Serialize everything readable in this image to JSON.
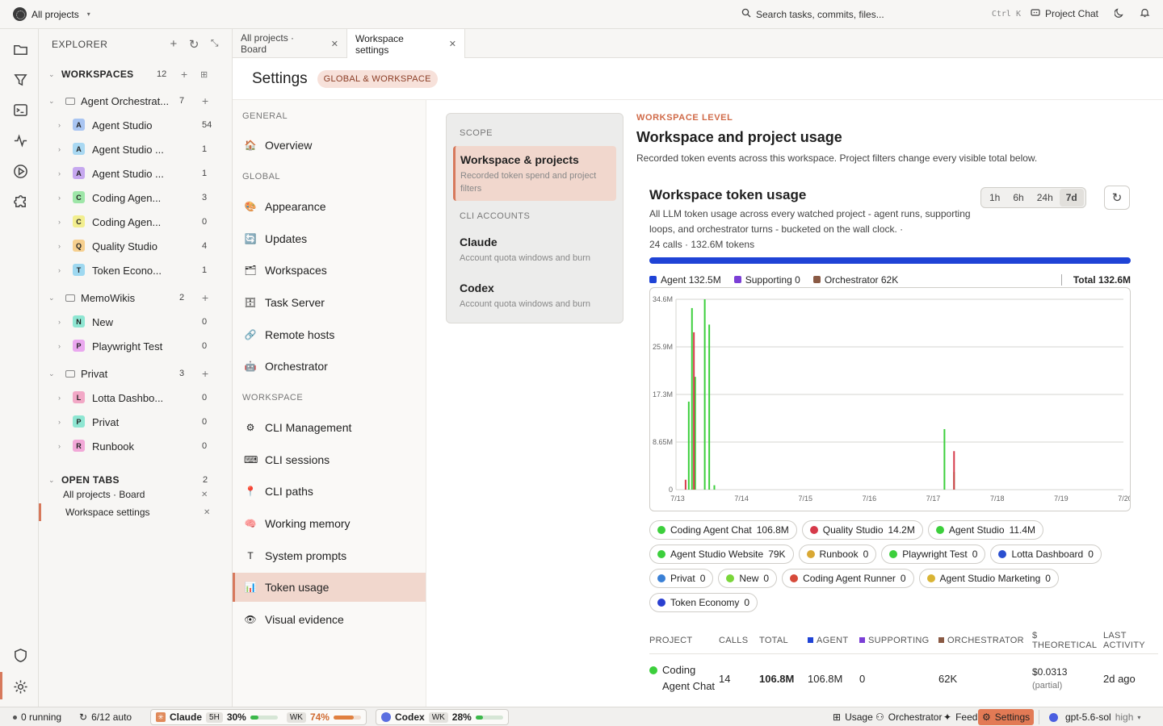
{
  "topbar": {
    "project_label": "All projects",
    "search_placeholder": "Search tasks, commits, files...",
    "shortcut": "Ctrl K",
    "project_chat": "Project Chat"
  },
  "explorer": {
    "title": "EXPLORER",
    "workspaces_label": "WORKSPACES",
    "workspaces_count": "12",
    "groups": [
      {
        "name": "Agent Orchestrat...",
        "count": "7",
        "items": [
          {
            "letter": "A",
            "name": "Agent Studio",
            "count": "54",
            "color": "#a9c5f2"
          },
          {
            "letter": "A",
            "name": "Agent Studio ...",
            "count": "1",
            "color": "#a9d8f2"
          },
          {
            "letter": "A",
            "name": "Agent Studio ...",
            "count": "1",
            "color": "#c6a8ef"
          },
          {
            "letter": "C",
            "name": "Coding Agen...",
            "count": "3",
            "color": "#9ee6a8"
          },
          {
            "letter": "C",
            "name": "Coding Agen...",
            "count": "0",
            "color": "#f2ee8e"
          },
          {
            "letter": "Q",
            "name": "Quality Studio",
            "count": "4",
            "color": "#f6cf8e"
          },
          {
            "letter": "T",
            "name": "Token Econo...",
            "count": "1",
            "color": "#9ed8f0"
          }
        ]
      },
      {
        "name": "MemoWikis",
        "count": "2",
        "items": [
          {
            "letter": "N",
            "name": "New",
            "count": "0",
            "color": "#8ee6d2"
          },
          {
            "letter": "P",
            "name": "Playwright Test",
            "count": "0",
            "color": "#eaa8ef"
          }
        ]
      },
      {
        "name": "Privat",
        "count": "3",
        "items": [
          {
            "letter": "L",
            "name": "Lotta Dashbo...",
            "count": "0",
            "color": "#f2a8c6"
          },
          {
            "letter": "P",
            "name": "Privat",
            "count": "0",
            "color": "#8ee6d2"
          },
          {
            "letter": "R",
            "name": "Runbook",
            "count": "0",
            "color": "#f2a8d8"
          }
        ]
      }
    ],
    "open_tabs_label": "OPEN TABS",
    "open_tabs_count": "2",
    "open_tabs": [
      "All projects · Board",
      "Workspace settings"
    ]
  },
  "tabs": [
    {
      "label": "All projects · Board"
    },
    {
      "label": "Workspace settings"
    }
  ],
  "settings": {
    "title": "Settings",
    "badge": "GLOBAL & WORKSPACE",
    "nav": {
      "general_label": "GENERAL",
      "global_label": "GLOBAL",
      "workspace_label": "WORKSPACE",
      "general": [
        {
          "icon": "🏠",
          "label": "Overview"
        }
      ],
      "global": [
        {
          "icon": "🎨",
          "label": "Appearance"
        },
        {
          "icon": "🔄",
          "label": "Updates"
        },
        {
          "icon": "🗂",
          "label": "Workspaces"
        },
        {
          "icon": "🗄",
          "label": "Task Server"
        },
        {
          "icon": "🔗",
          "label": "Remote hosts"
        },
        {
          "icon": "🤖",
          "label": "Orchestrator"
        }
      ],
      "workspace": [
        {
          "icon": "⚙",
          "label": "CLI Management"
        },
        {
          "icon": "⌨",
          "label": "CLI sessions"
        },
        {
          "icon": "📍",
          "label": "CLI paths"
        },
        {
          "icon": "🧠",
          "label": "Working memory"
        },
        {
          "icon": "T",
          "label": "System prompts"
        },
        {
          "icon": "📊",
          "label": "Token usage"
        },
        {
          "icon": "👁",
          "label": "Visual evidence"
        }
      ]
    },
    "scope": {
      "scope_label": "SCOPE",
      "cli_label": "CLI ACCOUNTS",
      "selected_title": "Workspace & projects",
      "selected_desc": "Recorded token spend and project filters",
      "claude_title": "Claude",
      "claude_desc": "Account quota windows and burn",
      "codex_title": "Codex",
      "codex_desc": "Account quota windows and burn"
    },
    "content": {
      "eyebrow": "WORKSPACE LEVEL",
      "title": "Workspace and project usage",
      "subtitle": "Recorded token events across this workspace. Project filters change every visible total below.",
      "card_title": "Workspace token usage",
      "card_desc": "All LLM token usage across every watched project - agent runs, supporting loops, and orchestrator turns - bucketed on the wall clock. ·",
      "card_stats": "24 calls · 132.6M tokens",
      "ranges": [
        "1h",
        "6h",
        "24h",
        "7d"
      ],
      "selected_range": "7d",
      "legend": {
        "agent": "Agent",
        "agent_val": "132.5M",
        "supporting": "Supporting",
        "supporting_val": "0",
        "orchestrator": "Orchestrator",
        "orchestrator_val": "62K",
        "total": "Total 132.6M"
      },
      "colors": {
        "agent": "#1f43d6",
        "supporting": "#7b3fd6",
        "orchestrator": "#8a5a44"
      }
    }
  },
  "chart_data": {
    "type": "bar",
    "y_ticks": [
      "0",
      "8.65M",
      "17.3M",
      "25.9M",
      "34.6M"
    ],
    "x_ticks": [
      "7/13",
      "7/14",
      "7/15",
      "7/16",
      "7/17",
      "7/18",
      "7/19",
      "7/20"
    ],
    "ylim": [
      0,
      34.6
    ],
    "xlim": [
      0,
      7
    ],
    "series": [
      {
        "name": "Coding Agent Chat",
        "color": "#3ccf3c",
        "points": [
          [
            0.2,
            16
          ],
          [
            0.25,
            33
          ],
          [
            0.3,
            20.5
          ],
          [
            0.45,
            34.6
          ],
          [
            0.52,
            30
          ],
          [
            0.6,
            0.8
          ],
          [
            4.2,
            11
          ],
          [
            4.35,
            3.2
          ]
        ]
      },
      {
        "name": "Quality Studio",
        "color": "#d63a4a",
        "points": [
          [
            0.15,
            1.8
          ],
          [
            0.28,
            28.6
          ],
          [
            4.35,
            7.0
          ]
        ]
      }
    ]
  },
  "pills": [
    {
      "name": "Coding Agent Chat",
      "val": "106.8M",
      "color": "#3ccf3c"
    },
    {
      "name": "Quality Studio",
      "val": "14.2M",
      "color": "#d63a4a"
    },
    {
      "name": "Agent Studio",
      "val": "11.4M",
      "color": "#3ccf3c"
    },
    {
      "name": "Agent Studio Website",
      "val": "79K",
      "color": "#3ccf3c"
    },
    {
      "name": "Runbook",
      "val": "0",
      "color": "#d9a834"
    },
    {
      "name": "Playwright Test",
      "val": "0",
      "color": "#3ccf3c"
    },
    {
      "name": "Lotta Dashboard",
      "val": "0",
      "color": "#2a4fd0"
    },
    {
      "name": "Privat",
      "val": "0",
      "color": "#3a80d6"
    },
    {
      "name": "New",
      "val": "0",
      "color": "#7ad63a"
    },
    {
      "name": "Coding Agent Runner",
      "val": "0",
      "color": "#d64a3a"
    },
    {
      "name": "Agent Studio Marketing",
      "val": "0",
      "color": "#d9b434"
    },
    {
      "name": "Token Economy",
      "val": "0",
      "color": "#2a3fd0"
    }
  ],
  "table": {
    "headers": [
      "PROJECT",
      "CALLS",
      "TOTAL",
      "AGENT",
      "SUPPORTING",
      "ORCHESTRATOR",
      "$ THEORETICAL",
      "LAST ACTIVITY"
    ],
    "row": {
      "project": "Coding Agent Chat",
      "calls": "14",
      "total": "106.8M",
      "agent": "106.8M",
      "supporting": "0",
      "orchestrator": "62K",
      "cost": "$0.0313",
      "cost_note": "(partial)",
      "last": "2d ago"
    }
  },
  "statusbar": {
    "running": "0 running",
    "auto": "6/12 auto",
    "claude": "Claude",
    "claude_5h_tag": "5H",
    "claude_5h": "30%",
    "claude_5h_level": 0.3,
    "claude_wk_tag": "WK",
    "claude_wk": "74%",
    "claude_wk_level": 0.74,
    "codex": "Codex",
    "codex_wk_tag": "WK",
    "codex_wk": "28%",
    "codex_wk_level": 0.28,
    "usage": "Usage",
    "orchestrator": "Orchestrator",
    "feed": "Feed",
    "settings": "Settings",
    "model": "gpt-5.6-sol",
    "effort": "high"
  }
}
